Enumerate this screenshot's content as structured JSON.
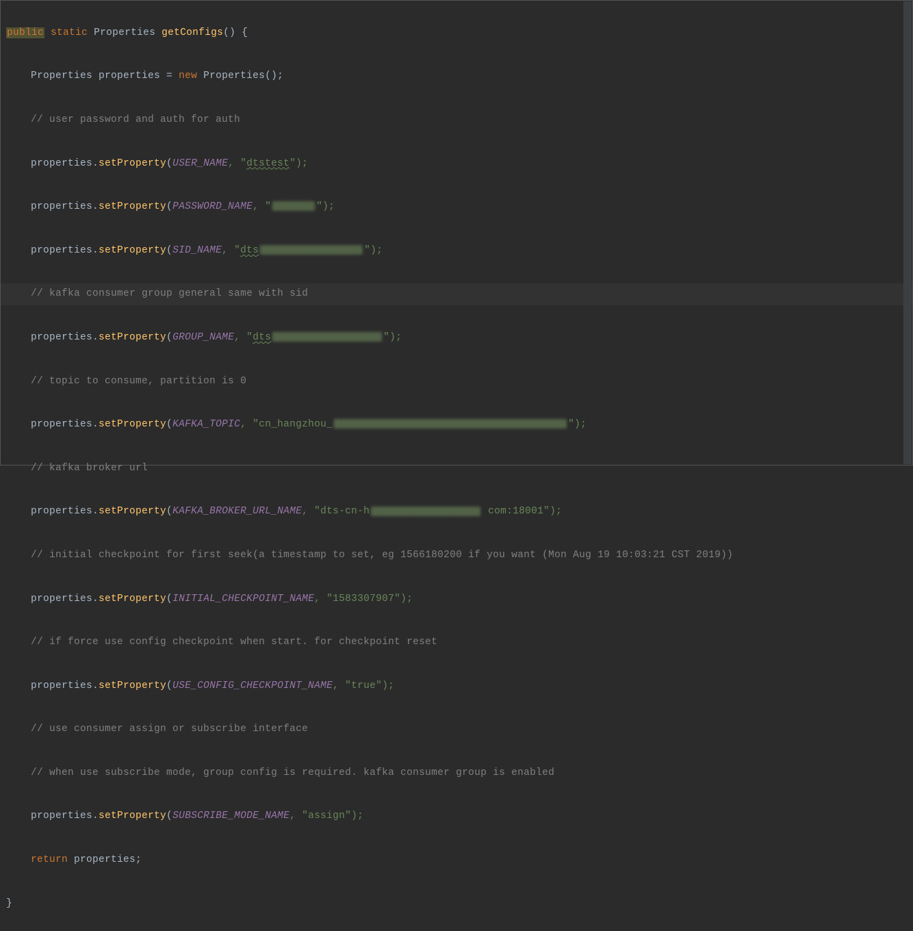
{
  "code": {
    "sig": {
      "public": "public",
      "static": "static",
      "type1": "Properties",
      "method": "getConfigs",
      "paren_open": "()",
      "brace": " {"
    },
    "l2": {
      "type1": "Properties ",
      "var": "properties = ",
      "new": "new",
      "type2": " Properties",
      "tail": "();"
    },
    "c1": "// user password and auth for auth",
    "l4": {
      "pre": "properties.",
      "call": "setProperty",
      "open": "(",
      "const": "USER_NAME",
      "mid": ", \"",
      "val": "dtstest",
      "end": "\");"
    },
    "l5": {
      "pre": "properties.",
      "call": "setProperty",
      "open": "(",
      "const": "PASSWORD_NAME",
      "mid": ", \"",
      "end": "\");",
      "blur_w": 62
    },
    "l6": {
      "pre": "properties.",
      "call": "setProperty",
      "open": "(",
      "const": "SID_NAME",
      "mid": ", \"",
      "val_head": "dts",
      "end": "\");",
      "blur_w": 150
    },
    "c2": "// kafka consumer group general same with sid",
    "l8": {
      "pre": "properties.",
      "call": "setProperty",
      "open": "(",
      "const": "GROUP_NAME",
      "mid": ", \"",
      "val_head": "dts",
      "end": "\");",
      "blur_w": 160
    },
    "c3": "// topic to consume, partition is 0",
    "l10": {
      "pre": "properties.",
      "call": "setProperty",
      "open": "(",
      "const": "KAFKA_TOPIC",
      "mid": ", \"",
      "val_head": "cn_hangzhou_",
      "end": "\");",
      "blur_w": 340
    },
    "c4": "// kafka broker url",
    "l12": {
      "pre": "properties.",
      "call": "setProperty",
      "open": "(",
      "const": "KAFKA_BROKER_URL_NAME",
      "mid": ", \"",
      "val_head": "dts-cn-h",
      "val_tail": " com:18001",
      "end": "\");",
      "blur_w": 160
    },
    "c5": "// initial checkpoint for first seek(a timestamp to set, eg 1566180200 if you want (Mon Aug 19 10:03:21 CST 2019))",
    "l14": {
      "pre": "properties.",
      "call": "setProperty",
      "open": "(",
      "const": "INITIAL_CHECKPOINT_NAME",
      "mid": ", \"",
      "val": "1583307907",
      "end": "\");"
    },
    "c6": "// if force use config checkpoint when start. for checkpoint reset",
    "l16": {
      "pre": "properties.",
      "call": "setProperty",
      "open": "(",
      "const": "USE_CONFIG_CHECKPOINT_NAME",
      "mid": ", \"",
      "val": "true",
      "end": "\");"
    },
    "c7": "// use consumer assign or subscribe interface",
    "c8": "// when use subscribe mode, group config is required. kafka consumer group is enabled",
    "l19": {
      "pre": "properties.",
      "call": "setProperty",
      "open": "(",
      "const": "SUBSCRIBE_MODE_NAME",
      "mid": ", \"",
      "val": "assign",
      "end": "\");"
    },
    "l20": {
      "ret": "return",
      "tail": " properties;"
    },
    "l21": "}"
  }
}
